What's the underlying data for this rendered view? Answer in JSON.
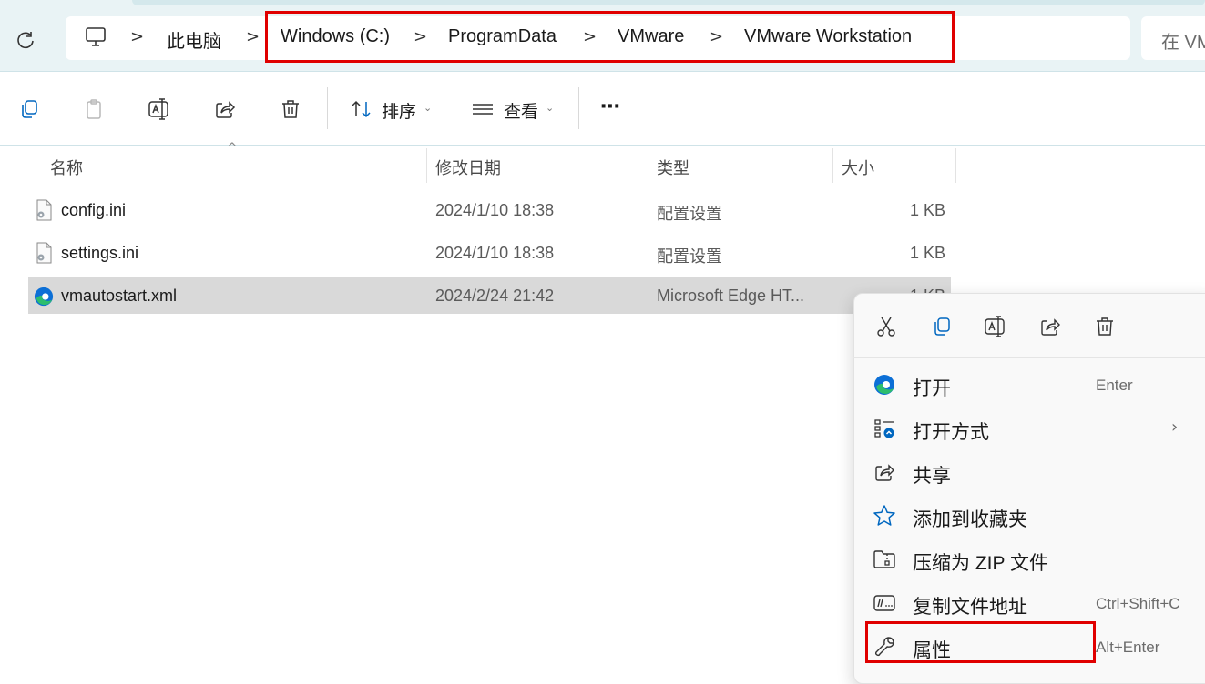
{
  "breadcrumb": {
    "items": [
      "此电脑",
      "Windows (C:)",
      "ProgramData",
      "VMware",
      "VMware Workstation"
    ],
    "separator": ">"
  },
  "search": {
    "placeholder": "在 VM"
  },
  "toolbar": {
    "sort_label": "排序",
    "view_label": "查看",
    "more_label": "⋯"
  },
  "columns": {
    "name": "名称",
    "modified": "修改日期",
    "type": "类型",
    "size": "大小"
  },
  "files": [
    {
      "name": "config.ini",
      "modified": "2024/1/10 18:38",
      "type": "配置设置",
      "size": "1 KB",
      "icon": "ini-file-icon"
    },
    {
      "name": "settings.ini",
      "modified": "2024/1/10 18:38",
      "type": "配置设置",
      "size": "1 KB",
      "icon": "ini-file-icon"
    },
    {
      "name": "vmautostart.xml",
      "modified": "2024/2/24 21:42",
      "type": "Microsoft Edge HT...",
      "size": "1 KB",
      "icon": "edge-icon",
      "selected": true
    }
  ],
  "context_menu": {
    "top_actions": [
      "cut-icon",
      "copy-icon",
      "rename-icon",
      "share-icon",
      "delete-icon"
    ],
    "items": [
      {
        "label": "打开",
        "shortcut": "Enter",
        "icon": "edge-icon"
      },
      {
        "label": "打开方式",
        "shortcut": "",
        "icon": "open-with-icon",
        "submenu": true
      },
      {
        "label": "共享",
        "shortcut": "",
        "icon": "share-icon"
      },
      {
        "label": "添加到收藏夹",
        "shortcut": "",
        "icon": "star-icon"
      },
      {
        "label": "压缩为 ZIP 文件",
        "shortcut": "",
        "icon": "zip-icon"
      },
      {
        "label": "复制文件地址",
        "shortcut": "Ctrl+Shift+C",
        "icon": "copy-path-icon"
      },
      {
        "label": "属性",
        "shortcut": "Alt+Enter",
        "icon": "wrench-icon"
      }
    ]
  },
  "colors": {
    "highlight": "#e00000",
    "selection": "#d9d9d9",
    "edge_blue": "#0c6fd6",
    "edge_green": "#2dbd6e"
  }
}
